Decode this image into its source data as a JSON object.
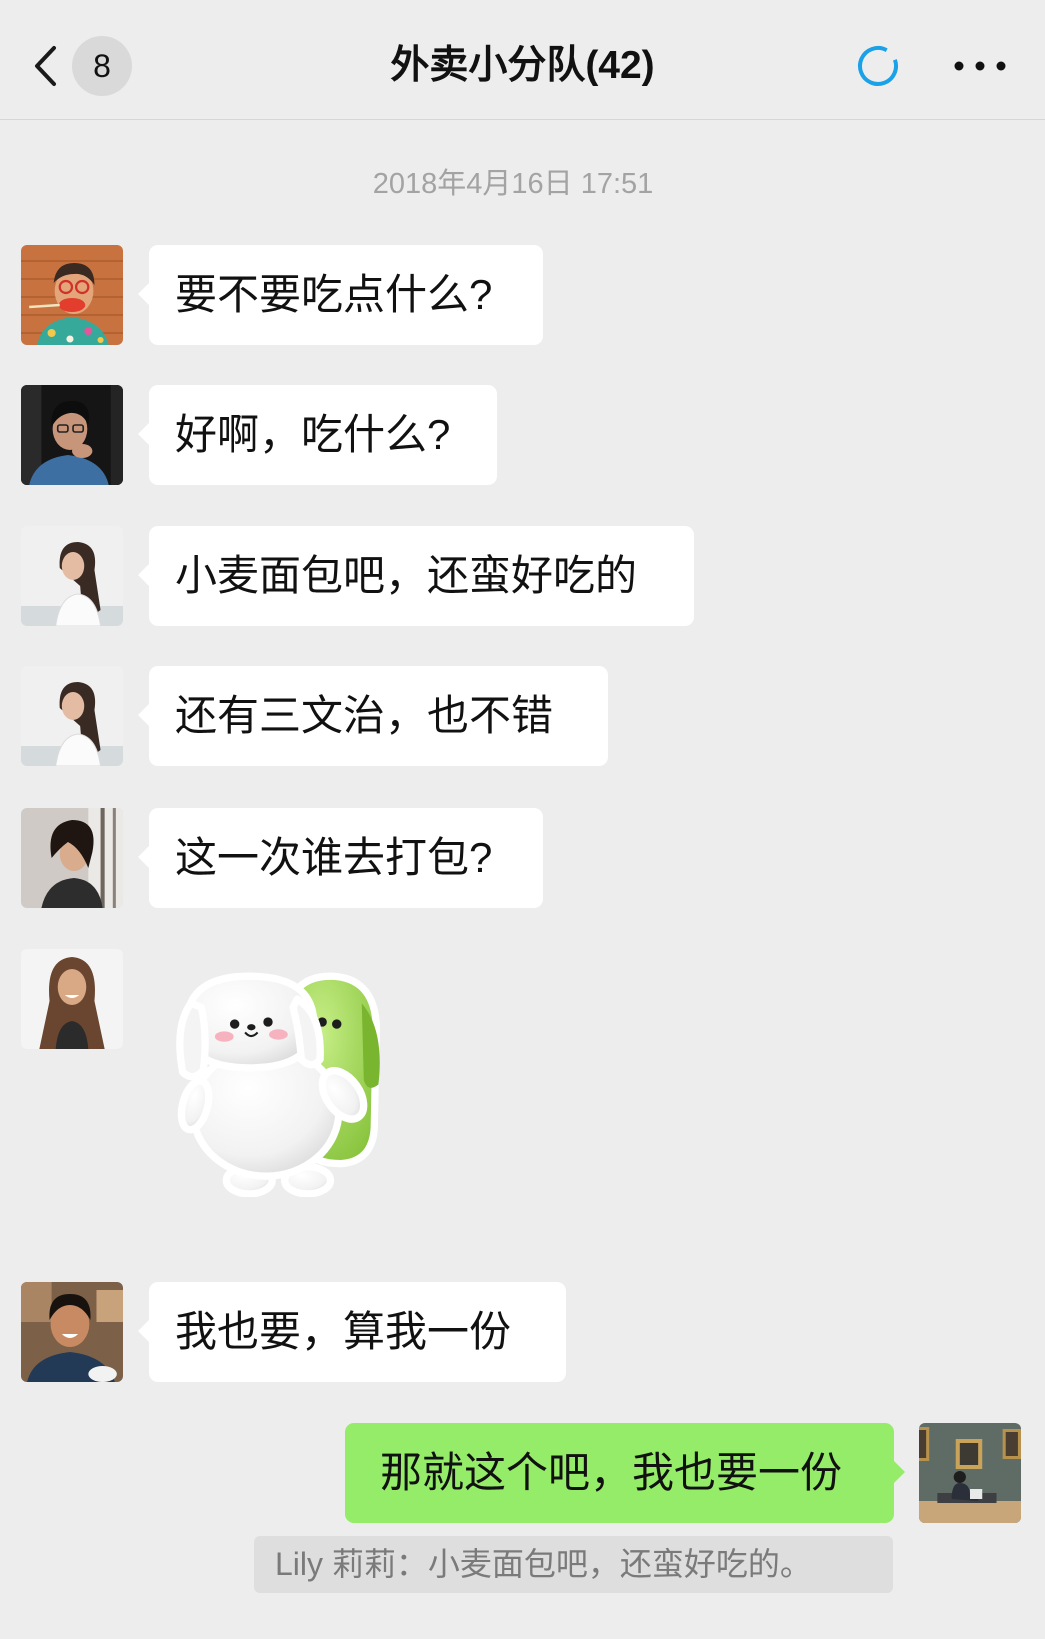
{
  "header": {
    "unread_badge": "8",
    "title": "外卖小分队(42)",
    "back_icon": "chevron-left-icon",
    "status_icon": "loading-ring-icon",
    "more_icon": "more-dots-icon"
  },
  "colors": {
    "background": "#ededed",
    "incoming_bubble": "#ffffff",
    "outgoing_bubble": "#95ec69",
    "status_ring": "#1aa1e8",
    "timestamp_text": "#a3a3a3",
    "quote_background": "#dedede"
  },
  "timestamp": "2018年4月16日 17:51",
  "messages": [
    {
      "text": "要不要吃点什么?"
    },
    {
      "text": "好啊，吃什么?"
    },
    {
      "text": "小麦面包吧，还蛮好吃的"
    },
    {
      "text": "还有三文治，也不错"
    },
    {
      "text": "这一次谁去打包?"
    },
    {
      "sticker_icon": "dog-sticker-icon"
    },
    {
      "text": "我也要，算我一份"
    }
  ],
  "my_message": {
    "text": "那就这个吧，我也要一份",
    "quote": "Lily 莉莉：小麦面包吧，还蛮好吃的。"
  }
}
